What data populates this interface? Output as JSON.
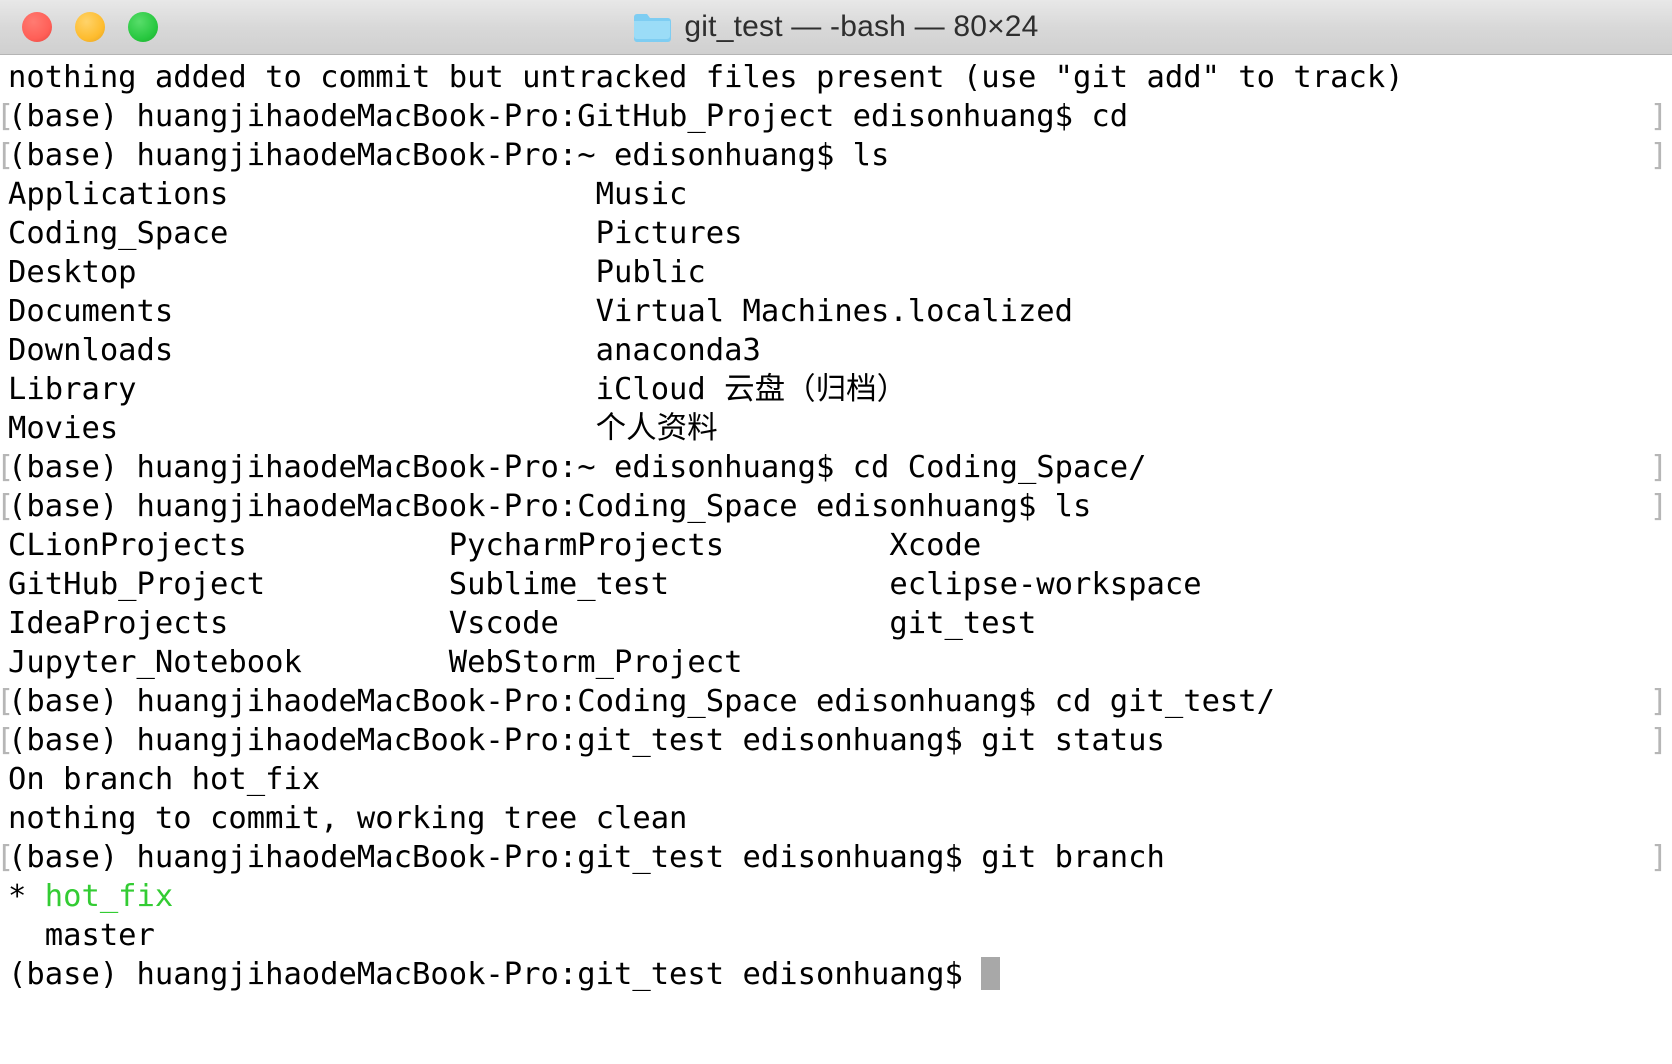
{
  "window": {
    "title": "git_test — -bash — 80×24",
    "folder_icon": "folder-icon",
    "controls": {
      "close": "close-button",
      "minimize": "minimize-button",
      "maximize": "maximize-button"
    },
    "colors": {
      "close": "#ff5f57",
      "minimize": "#febc2e",
      "maximize": "#28c840",
      "titlebar": "#d8d8d8",
      "folder": "#6fc9f5",
      "background": "#ffffff",
      "text": "#000000",
      "branch_green": "#33cc33",
      "command_mark": "#b6b6b6",
      "cursor": "#a8a8a8"
    }
  },
  "terminal": {
    "columns": 80,
    "rows": 24,
    "shell": "-bash",
    "prompt_user": "edisonhuang",
    "prompt_host": "huangjihaodeMacBook-Pro",
    "conda_env": "(base)",
    "lines": [
      {
        "marked": false,
        "text": "nothing added to commit but untracked files present (use \"git add\" to track)"
      },
      {
        "marked": true,
        "text": "(base) huangjihaodeMacBook-Pro:GitHub_Project edisonhuang$ cd"
      },
      {
        "marked": true,
        "text": "(base) huangjihaodeMacBook-Pro:~ edisonhuang$ ls"
      },
      {
        "marked": false,
        "text": "Applications                    Music"
      },
      {
        "marked": false,
        "text": "Coding_Space                    Pictures"
      },
      {
        "marked": false,
        "text": "Desktop                         Public"
      },
      {
        "marked": false,
        "text": "Documents                       Virtual Machines.localized"
      },
      {
        "marked": false,
        "text": "Downloads                       anaconda3"
      },
      {
        "marked": false,
        "text": "Library                         iCloud 云盘（归档）"
      },
      {
        "marked": false,
        "text": "Movies                          个人资料"
      },
      {
        "marked": true,
        "text": "(base) huangjihaodeMacBook-Pro:~ edisonhuang$ cd Coding_Space/"
      },
      {
        "marked": true,
        "text": "(base) huangjihaodeMacBook-Pro:Coding_Space edisonhuang$ ls"
      },
      {
        "marked": false,
        "text": "CLionProjects           PycharmProjects         Xcode"
      },
      {
        "marked": false,
        "text": "GitHub_Project          Sublime_test            eclipse-workspace"
      },
      {
        "marked": false,
        "text": "IdeaProjects            Vscode                  git_test"
      },
      {
        "marked": false,
        "text": "Jupyter_Notebook        WebStorm_Project"
      },
      {
        "marked": true,
        "text": "(base) huangjihaodeMacBook-Pro:Coding_Space edisonhuang$ cd git_test/"
      },
      {
        "marked": true,
        "text": "(base) huangjihaodeMacBook-Pro:git_test edisonhuang$ git status"
      },
      {
        "marked": false,
        "text": "On branch hot_fix"
      },
      {
        "marked": false,
        "text": "nothing to commit, working tree clean"
      },
      {
        "marked": true,
        "text": "(base) huangjihaodeMacBook-Pro:git_test edisonhuang$ git branch"
      },
      {
        "marked": false,
        "segments": [
          {
            "text": "* ",
            "color": "black"
          },
          {
            "text": "hot_fix",
            "color": "green"
          }
        ]
      },
      {
        "marked": false,
        "text": "  master"
      },
      {
        "marked": false,
        "text": "(base) huangjihaodeMacBook-Pro:git_test edisonhuang$ ",
        "cursor": true
      }
    ],
    "home_listing": {
      "column_1": [
        "Applications",
        "Coding_Space",
        "Desktop",
        "Documents",
        "Downloads",
        "Library",
        "Movies"
      ],
      "column_2": [
        "Music",
        "Pictures",
        "Public",
        "Virtual Machines.localized",
        "anaconda3",
        "iCloud 云盘（归档）",
        "个人资料"
      ]
    },
    "coding_space_listing": {
      "column_1": [
        "CLionProjects",
        "GitHub_Project",
        "IdeaProjects",
        "Jupyter_Notebook"
      ],
      "column_2": [
        "PycharmProjects",
        "Sublime_test",
        "Vscode",
        "WebStorm_Project"
      ],
      "column_3": [
        "Xcode",
        "eclipse-workspace",
        "git_test"
      ]
    },
    "git": {
      "status_branch": "On branch hot_fix",
      "status_clean": "nothing to commit, working tree clean",
      "branches": [
        "hot_fix",
        "master"
      ],
      "current_branch": "hot_fix"
    }
  }
}
